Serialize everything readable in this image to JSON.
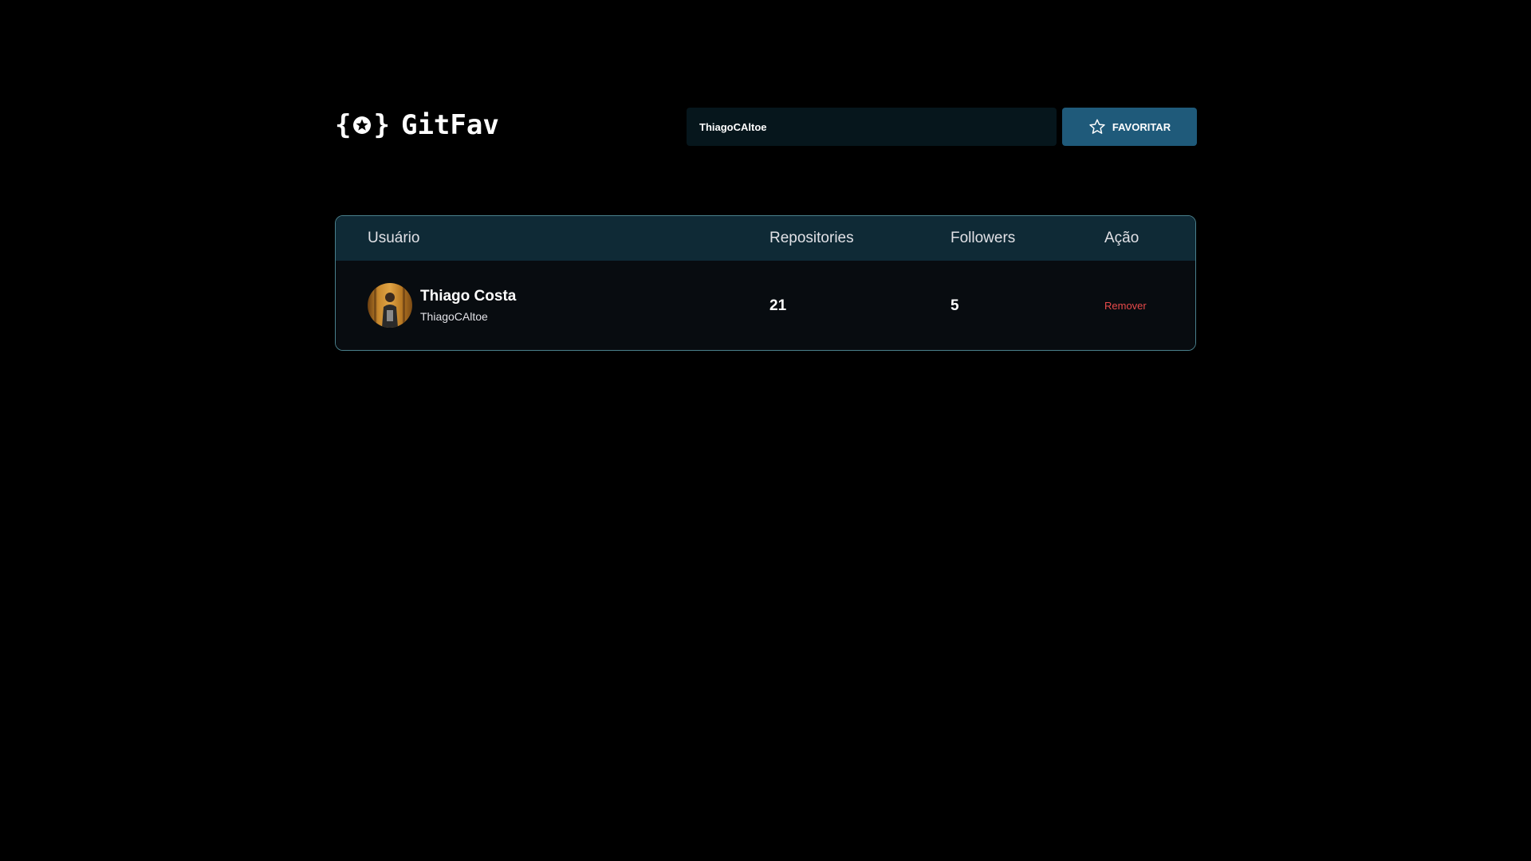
{
  "header": {
    "logo_text": "GitFav",
    "logo_icon": "star-braces-icon"
  },
  "search": {
    "value": "ThiagoCAltoe",
    "placeholder": "Busque um usuário do GitHub"
  },
  "favorite_button": {
    "label": "FAVORITAR",
    "icon": "star-outline-icon"
  },
  "table": {
    "columns": [
      "Usuário",
      "Repositories",
      "Followers",
      "Ação"
    ],
    "rows": [
      {
        "name": "Thiago Costa",
        "login": "ThiagoCAltoe",
        "repositories": "21",
        "followers": "5",
        "action_label": "Remover"
      }
    ]
  },
  "colors": {
    "background": "#000000",
    "input_bg": "#06161c",
    "button_bg": "#1f5a7a",
    "table_header_bg": "#0f2a36",
    "table_border": "#4a808c",
    "remove_color": "#e84a4a"
  }
}
